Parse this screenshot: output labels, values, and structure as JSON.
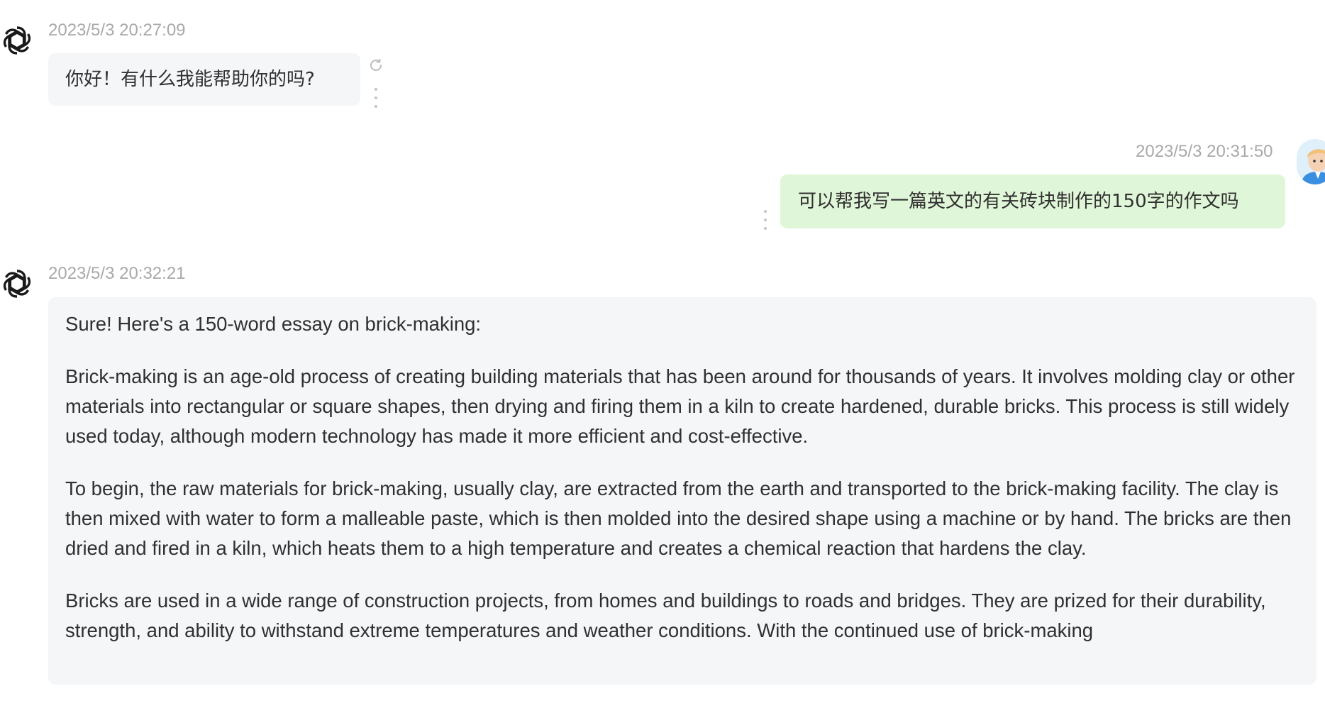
{
  "colors": {
    "bot_bubble": "#f4f6f8",
    "user_bubble": "#e0f6d8",
    "timestamp": "#a9a9a9",
    "text": "#303030"
  },
  "messages": [
    {
      "role": "assistant",
      "avatar_icon": "openai-logo-icon",
      "timestamp": "2023/5/3 20:27:09",
      "text": "你好！有什么我能帮助你的吗?"
    },
    {
      "role": "user",
      "avatar_icon": "user-avatar",
      "timestamp": "2023/5/3 20:31:50",
      "text": "可以帮我写一篇英文的有关砖块制作的150字的作文吗"
    },
    {
      "role": "assistant",
      "avatar_icon": "openai-logo-icon",
      "timestamp": "2023/5/3 20:32:21",
      "paragraphs": [
        "Sure! Here's a 150-word essay on brick-making:",
        "Brick-making is an age-old process of creating building materials that has been around for thousands of years. It involves molding clay or other materials into rectangular or square shapes, then drying and firing them in a kiln to create hardened, durable bricks. This process is still widely used today, although modern technology has made it more efficient and cost-effective.",
        "To begin, the raw materials for brick-making, usually clay, are extracted from the earth and transported to the brick-making facility. The clay is then mixed with water to form a malleable paste, which is then molded into the desired shape using a machine or by hand. The bricks are then dried and fired in a kiln, which heats them to a high temperature and creates a chemical reaction that hardens the clay.",
        "Bricks are used in a wide range of construction projects, from homes and buildings to roads and bridges. They are prized for their durability, strength, and ability to withstand extreme temperatures and weather conditions. With the continued use of brick-making"
      ]
    }
  ]
}
